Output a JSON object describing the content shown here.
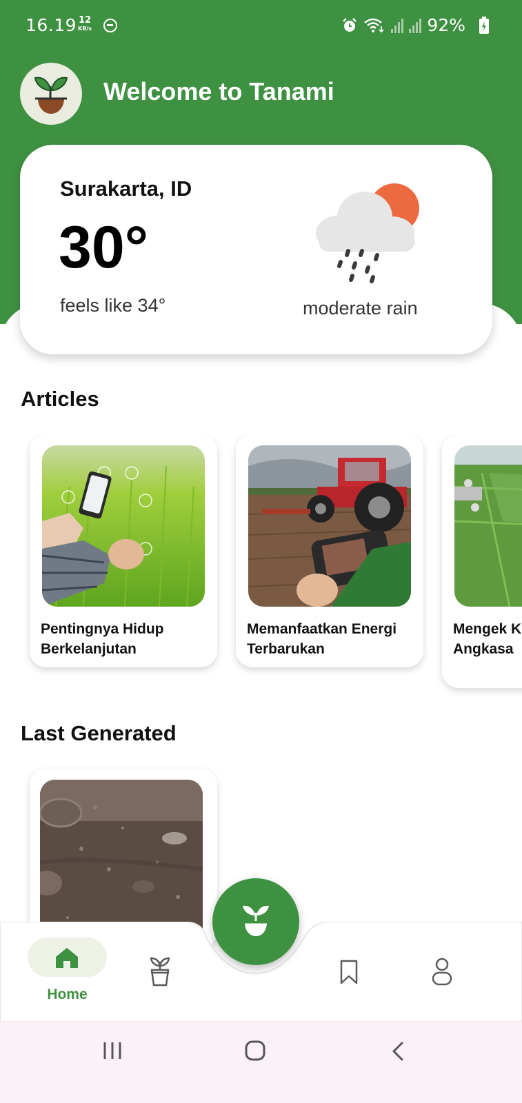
{
  "status_bar": {
    "time": "16.19",
    "net_speed": "12",
    "net_unit": "KB/s",
    "battery": "92%",
    "icons": [
      "dnd-icon",
      "alarm-icon",
      "wifi-icon",
      "signal-icon",
      "signal-icon",
      "battery-charging-icon"
    ]
  },
  "header": {
    "welcome": "Welcome to Tanami",
    "logo_icon": "sprout-icon"
  },
  "weather": {
    "city": "Surakarta, ID",
    "temperature": "30°",
    "feels_like": "feels like 34°",
    "condition": "moderate rain",
    "icon": "rain-cloud-sun-icon"
  },
  "articles": {
    "title": "Articles",
    "items": [
      {
        "title": "Pentingnya Hidup Berkelanjutan"
      },
      {
        "title": "Memanfaatkan Energi Terbarukan"
      },
      {
        "title": "Mengek Keajaiba Angkasa"
      }
    ]
  },
  "last_generated": {
    "title": "Last Generated"
  },
  "bottom_nav": {
    "items": [
      {
        "label": "Home",
        "icon": "home-icon",
        "active": true
      },
      {
        "label": "",
        "icon": "plant-pot-icon"
      },
      {
        "label": "",
        "icon": "bookmark-icon"
      },
      {
        "label": "",
        "icon": "profile-icon"
      }
    ],
    "fab_icon": "sprout-icon"
  },
  "system_nav": {
    "icons": [
      "recents-icon",
      "home-circle-icon",
      "back-icon"
    ]
  },
  "colors": {
    "primary": "#3f9142",
    "background": "#ffffff",
    "sun": "#ec6a3f"
  }
}
